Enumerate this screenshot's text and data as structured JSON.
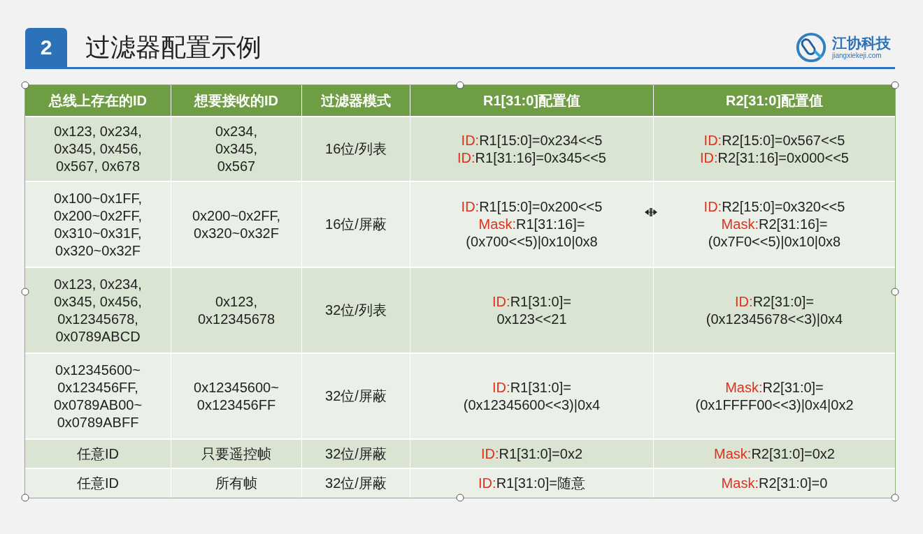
{
  "slide": {
    "number": "2",
    "title": "过滤器配置示例",
    "logo": {
      "name": "江协科技",
      "site": "jiangxiekeji.com"
    }
  },
  "table": {
    "columns": [
      "总线上存在的ID",
      "想要接收的ID",
      "过滤器模式",
      "R1[31:0]配置值",
      "R2[31:0]配置值"
    ],
    "rows": [
      {
        "bus_ids": [
          "0x123, 0x234,",
          "0x345, 0x456,",
          "0x567, 0x678"
        ],
        "wanted_ids": [
          "0x234,",
          "0x345,",
          "0x567"
        ],
        "mode": "16位/列表",
        "r1": [
          {
            "key": "ID:",
            "expr": "R1[15:0]=0x234<<5"
          },
          {
            "key": "ID:",
            "expr": "R1[31:16]=0x345<<5"
          }
        ],
        "r2": [
          {
            "key": "ID:",
            "expr": "R2[15:0]=0x567<<5"
          },
          {
            "key": "ID:",
            "expr": "R2[31:16]=0x000<<5"
          }
        ]
      },
      {
        "bus_ids": [
          "0x100~0x1FF,",
          "0x200~0x2FF,",
          "0x310~0x31F,",
          "0x320~0x32F"
        ],
        "wanted_ids": [
          "0x200~0x2FF,",
          "0x320~0x32F"
        ],
        "mode": "16位/屏蔽",
        "r1": [
          {
            "key": "ID:",
            "expr": "R1[15:0]=0x200<<5"
          },
          {
            "key": "Mask:",
            "expr": "R1[31:16]="
          },
          {
            "expr": "(0x700<<5)|0x10|0x8"
          }
        ],
        "r2": [
          {
            "key": "ID:",
            "expr": "R2[15:0]=0x320<<5"
          },
          {
            "key": "Mask:",
            "expr": "R2[31:16]="
          },
          {
            "expr": "(0x7F0<<5)|0x10|0x8"
          }
        ]
      },
      {
        "bus_ids": [
          "0x123, 0x234,",
          "0x345, 0x456,",
          "0x12345678,",
          "0x0789ABCD"
        ],
        "wanted_ids": [
          "0x123,",
          "0x12345678"
        ],
        "mode": "32位/列表",
        "r1": [
          {
            "key": "ID:",
            "expr": "R1[31:0]="
          },
          {
            "expr": "0x123<<21"
          }
        ],
        "r2": [
          {
            "key": "ID:",
            "expr": "R2[31:0]="
          },
          {
            "expr": "(0x12345678<<3)|0x4"
          }
        ]
      },
      {
        "bus_ids": [
          "0x12345600~",
          "0x123456FF,",
          "0x0789AB00~",
          "0x0789ABFF"
        ],
        "wanted_ids": [
          "0x12345600~",
          "0x123456FF"
        ],
        "mode": "32位/屏蔽",
        "r1": [
          {
            "key": "ID:",
            "expr": "R1[31:0]="
          },
          {
            "expr": "(0x12345600<<3)|0x4"
          }
        ],
        "r2": [
          {
            "key": "Mask:",
            "expr": "R2[31:0]="
          },
          {
            "expr": "(0x1FFFF00<<3)|0x4|0x2"
          }
        ]
      },
      {
        "bus_ids": [
          "任意ID"
        ],
        "wanted_ids": [
          "只要遥控帧"
        ],
        "mode": "32位/屏蔽",
        "r1": [
          {
            "key": "ID:",
            "expr": "R1[31:0]=0x2"
          }
        ],
        "r2": [
          {
            "key": "Mask:",
            "expr": "R2[31:0]=0x2"
          }
        ]
      },
      {
        "bus_ids": [
          "任意ID"
        ],
        "wanted_ids": [
          "所有帧"
        ],
        "mode": "32位/屏蔽",
        "r1": [
          {
            "key": "ID:",
            "expr": "R1[31:0]=随意"
          }
        ],
        "r2": [
          {
            "key": "Mask:",
            "expr": "R2[31:0]=0"
          }
        ]
      }
    ]
  }
}
